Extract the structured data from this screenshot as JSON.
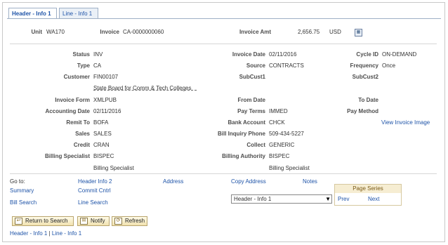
{
  "tabs": [
    {
      "label": "Header - Info 1",
      "active": true
    },
    {
      "label": "Line - Info 1",
      "active": false
    }
  ],
  "top": {
    "unit_label": "Unit",
    "unit_value": "WA170",
    "invoice_label": "Invoice",
    "invoice_value": "CA-0000000060",
    "amt_label": "Invoice Amt",
    "amt_value": "2,656.75",
    "currency": "USD",
    "export_icon": "grid-export-icon"
  },
  "fields": {
    "status": {
      "label": "Status",
      "value": "INV"
    },
    "type": {
      "label": "Type",
      "value": "CA"
    },
    "customer": {
      "label": "Customer",
      "value": "FIN00107",
      "name": "State Board for Comm & Tech Colleges"
    },
    "invoice_form": {
      "label": "Invoice Form",
      "value": "XMLPUB"
    },
    "accounting_date": {
      "label": "Accounting Date",
      "value": "02/11/2016"
    },
    "remit_to": {
      "label": "Remit To",
      "value": "BOFA"
    },
    "sales": {
      "label": "Sales",
      "value": "SALES"
    },
    "credit": {
      "label": "Credit",
      "value": "CRAN"
    },
    "billing_specialist": {
      "label": "Billing Specialist",
      "value": "BISPEC",
      "desc": "Billing Specialist"
    },
    "invoice_date": {
      "label": "Invoice Date",
      "value": "02/11/2016"
    },
    "source": {
      "label": "Source",
      "value": "CONTRACTS"
    },
    "subcust1": {
      "label": "SubCust1",
      "value": ""
    },
    "from_date": {
      "label": "From Date",
      "value": ""
    },
    "pay_terms": {
      "label": "Pay Terms",
      "value": "IMMED"
    },
    "bank_account": {
      "label": "Bank Account",
      "value": "CHCK"
    },
    "bill_inquiry_phone": {
      "label": "Bill Inquiry Phone",
      "value": "509-434-5227"
    },
    "collect": {
      "label": "Collect",
      "value": "GENERIC"
    },
    "billing_authority": {
      "label": "Billing Authority",
      "value": "BISPEC",
      "desc": "Billing Specialist"
    },
    "cycle_id": {
      "label": "Cycle ID",
      "value": "ON-DEMAND"
    },
    "frequency": {
      "label": "Frequency",
      "value": "Once"
    },
    "subcust2": {
      "label": "SubCust2",
      "value": ""
    },
    "to_date": {
      "label": "To Date",
      "value": ""
    },
    "pay_method": {
      "label": "Pay Method",
      "value": ""
    },
    "view_invoice_image": "View Invoice Image"
  },
  "goto": {
    "label": "Go to:",
    "links": {
      "header_info2": "Header Info 2",
      "address": "Address",
      "copy_address": "Copy Address",
      "notes": "Notes",
      "summary": "Summary",
      "commit_cntrl": "Commit Cntrl",
      "bill_search": "Bill Search",
      "line_search": "Line Search"
    }
  },
  "page_series": {
    "title": "Page Series",
    "selected": "Header - Info 1",
    "prev": "Prev",
    "next": "Next"
  },
  "buttons": {
    "return": "Return to Search",
    "notify": "Notify",
    "refresh": "Refresh"
  },
  "footer": {
    "link1": "Header - Info 1",
    "sep": "|",
    "link2": "Line - Info 1"
  }
}
